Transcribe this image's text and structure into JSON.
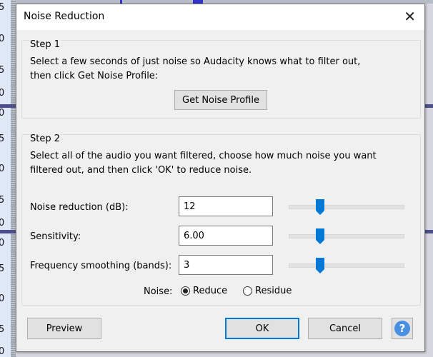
{
  "background": {
    "ruler_labels": [
      "5",
      "0",
      "5",
      "0",
      "0",
      "5",
      "0",
      "5",
      "0",
      "0",
      "5",
      "0",
      "5",
      "0"
    ]
  },
  "dialog": {
    "title": "Noise Reduction",
    "close_label": "✕",
    "step1": {
      "title": "Step 1",
      "description": "Select a few seconds of just noise so Audacity knows what to filter out,\nthen click Get Noise Profile:",
      "button_label": "Get Noise Profile"
    },
    "step2": {
      "title": "Step 2",
      "description": "Select all of the audio you want filtered, choose how much noise you want\nfiltered out, and then click 'OK' to reduce noise.",
      "controls": [
        {
          "label": "Noise reduction (dB):",
          "value": "12",
          "slider_fraction": 0.27
        },
        {
          "label": "Sensitivity:",
          "value": "6.00",
          "slider_fraction": 0.27
        },
        {
          "label": "Frequency smoothing (bands):",
          "value": "3",
          "slider_fraction": 0.27
        }
      ],
      "noise_label": "Noise:",
      "noise_options": [
        {
          "label": "Reduce",
          "selected": true
        },
        {
          "label": "Residue",
          "selected": false
        }
      ]
    },
    "buttons": {
      "preview": "Preview",
      "ok": "OK",
      "cancel": "Cancel",
      "help": "?"
    },
    "colors": {
      "accent": "#0078d7",
      "help_icon": "#4a90e2"
    }
  }
}
